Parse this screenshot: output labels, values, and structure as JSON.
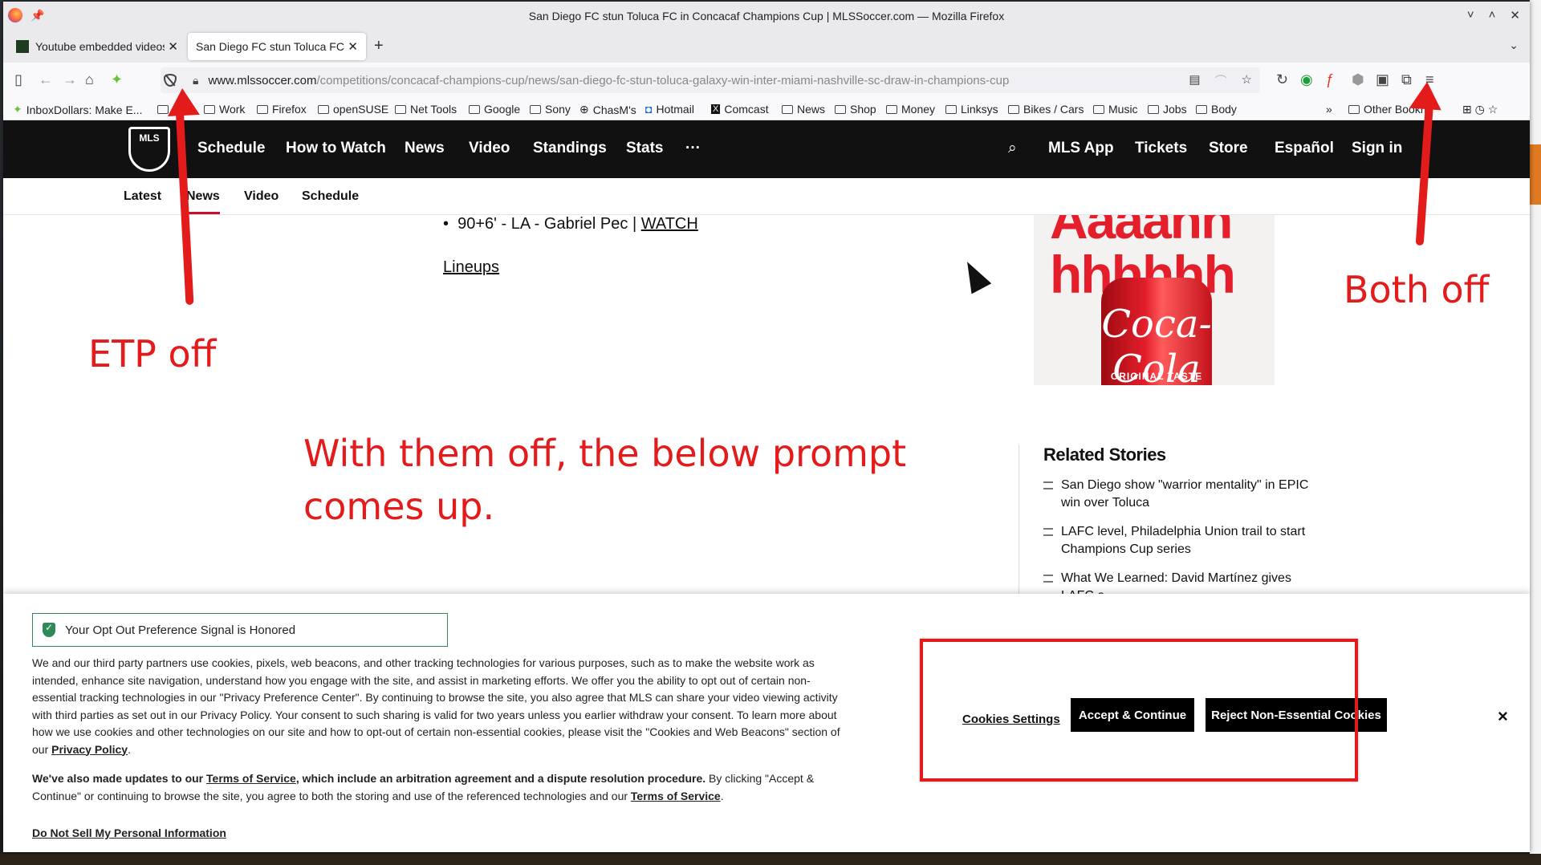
{
  "window": {
    "title": "San Diego FC stun Toluca FC in Concacaf Champions Cup | MLSSoccer.com — Mozilla Firefox",
    "controls": [
      "˅",
      "˄",
      "✕"
    ]
  },
  "tabs": [
    {
      "label": "Youtube embedded videos"
    },
    {
      "label": "San Diego FC stun Toluca FC in Concacaf Champions Cup"
    }
  ],
  "urlbar": {
    "host": "www.mlssoccer.com",
    "path": "/competitions/concacaf-champions-cup/news/san-diego-fc-stun-toluca-galaxy-win-inter-miami-nashville-sc-draw-in-champions-cup"
  },
  "bookmarks": [
    "InboxDollars: Make E...",
    "s",
    "Work",
    "Firefox",
    "openSUSE",
    "Net Tools",
    "Google",
    "Sony",
    "ChasM's",
    "Hotmail",
    "Comcast",
    "News",
    "Shop",
    "Money",
    "Linksys",
    "Bikes / Cars",
    "Music",
    "Jobs",
    "Body",
    "Other Bookm"
  ],
  "mls_nav": {
    "logo": "MLS",
    "left": [
      "Schedule",
      "How to Watch",
      "News",
      "Video",
      "Standings",
      "Stats",
      "···"
    ],
    "right": [
      "MLS App",
      "Tickets",
      "Store",
      "Español",
      "Sign in"
    ]
  },
  "subnav": [
    "Latest",
    "News",
    "Video",
    "Schedule"
  ],
  "article": {
    "bullet_text": "90+6' - LA - Gabriel Pec | ",
    "bullet_link": "WATCH",
    "lineups": "Lineups"
  },
  "ad": {
    "line1": "Aaaahh",
    "line2": "hhhhhh",
    "can_script": "Coca-Cola",
    "can_text": "ORIGINAL TASTE"
  },
  "related": {
    "title": "Related Stories",
    "items": [
      "San Diego show \"warrior mentality\" in EPIC win over Toluca",
      "LAFC level, Philadelphia Union trail to start Champions Cup series",
      "What We Learned: David Martínez gives LAFC a..."
    ]
  },
  "cookie": {
    "optout": "Your Opt Out Preference Signal is Honored",
    "p1_a": "We and our third party partners use cookies, pixels, web beacons, and other tracking technologies for various purposes, such as to make the website work as intended, enhance site navigation, understand how you engage with the site, and assist in marketing efforts. We offer you the ability to opt out of certain non-essential tracking technologies in our \"Privacy Preference Center\". By continuing to browse the site, you also agree that MLS can share your video viewing activity with third parties as set out in our Privacy Policy. Your consent to such sharing is valid for two years unless you earlier withdraw your consent. To learn more about how we use cookies and other technologies on our site and how to opt-out of certain non-essential cookies, please visit the \"Cookies and Web Beacons\" section of our ",
    "p1_link": "Privacy Policy",
    "p2_bold_a": "We've also made updates to our ",
    "p2_link": "Terms of Service",
    "p2_bold_b": ", which include an arbitration agreement and a dispute resolution procedure.",
    "p2_rest": " By clicking \"Accept & Continue\" or continuing to browse the site, you agree to both the storing and use of the referenced technologies and our ",
    "p2_link2": "Terms of Service",
    "dnsm": "Do Not Sell My Personal Information",
    "settings": "Cookies Settings",
    "accept": "Accept & Continue",
    "reject": "Reject Non-Essential Cookies",
    "close": "×"
  },
  "annotations": {
    "etp": "ETP off",
    "both": "Both off",
    "prompt_line1": "With them off, the below prompt",
    "prompt_line2": "comes up."
  },
  "colors": {
    "annotation": "#e41b1b",
    "mls_nav_bg": "#111111",
    "accent_red": "#c8102e",
    "optout_green": "#2e8b57"
  }
}
